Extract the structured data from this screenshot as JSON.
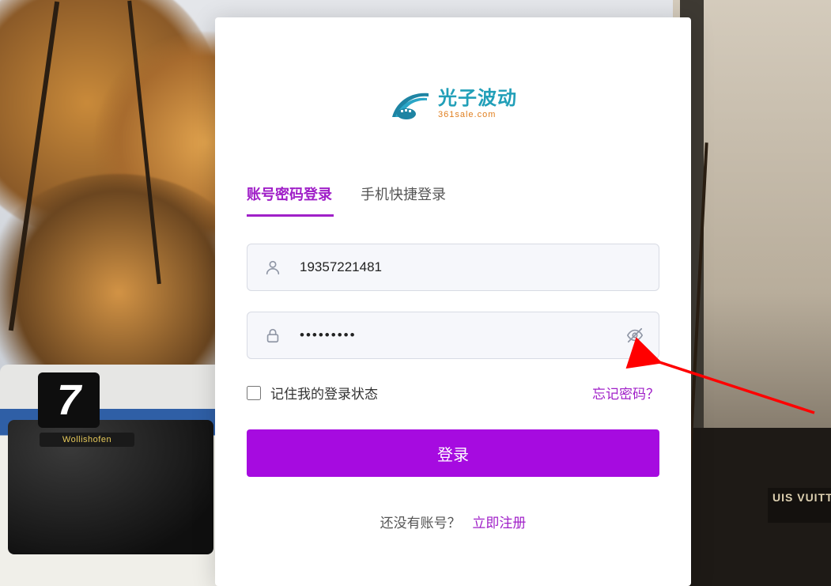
{
  "brand": {
    "cn": "光子波动",
    "en": "361sale.com"
  },
  "tabs": {
    "password": "账号密码登录",
    "sms": "手机快捷登录"
  },
  "form": {
    "account": {
      "value": "19357221481",
      "placeholder": ""
    },
    "password": {
      "value": "•••••••••",
      "placeholder": ""
    },
    "remember_label": "记住我的登录状态",
    "forgot": "忘记密码？",
    "login_btn": "登录"
  },
  "footer": {
    "prompt": "还没有账号？",
    "register": "立即注册"
  },
  "scene": {
    "tram_line": "7",
    "tram_destination": "Wollishofen",
    "store_sign": "UIS VUITT"
  },
  "colors": {
    "accent": "#a020c8",
    "button": "#a60be0",
    "brand_teal": "#219fb8",
    "brand_orange": "#e07f1f"
  }
}
